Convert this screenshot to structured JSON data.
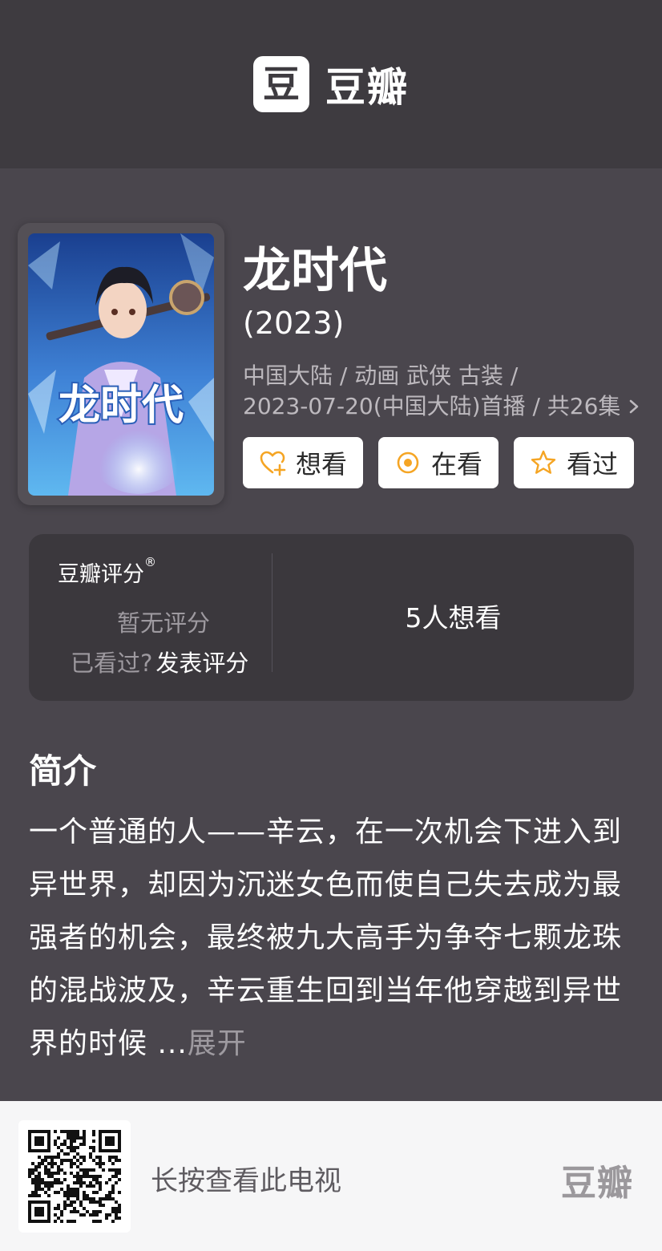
{
  "header": {
    "logo_glyph": "豆",
    "brand_name": "豆瓣"
  },
  "poster": {
    "title_text": "龙时代",
    "colors": {
      "bg_top": "#1a3f8f",
      "bg_bottom": "#5fb8f0",
      "accent": "#e9f6ff"
    }
  },
  "show": {
    "title": "龙时代",
    "year": "(2023)",
    "meta_line1": "中国大陆 / 动画 武侠 古装 /",
    "meta_line2": "2023-07-20(中国大陆)首播 / 共26集"
  },
  "actions": [
    {
      "label": "想看",
      "icon": "heart-plus-icon",
      "color": "#f5a524"
    },
    {
      "label": "在看",
      "icon": "target-icon",
      "color": "#f5a524"
    },
    {
      "label": "看过",
      "icon": "star-outline-icon",
      "color": "#f5a524"
    }
  ],
  "rating": {
    "title": "豆瓣评分",
    "registered_mark": "®",
    "no_rating": "暂无评分",
    "watched_prompt": "已看过?",
    "rate_link": "发表评分",
    "wish_count": "5人想看"
  },
  "intro": {
    "heading": "简介",
    "text": "一个普通的人——辛云，在一次机会下进入到异世界，却因为沉迷女色而使自己失去成为最强者的机会，最终被九大高手为争夺七颗龙珠的混战波及，辛云重生回到当年他穿越到异世界的时候 ...",
    "expand": "展开"
  },
  "footer": {
    "prompt": "长按查看此电视",
    "brand": "豆瓣"
  }
}
